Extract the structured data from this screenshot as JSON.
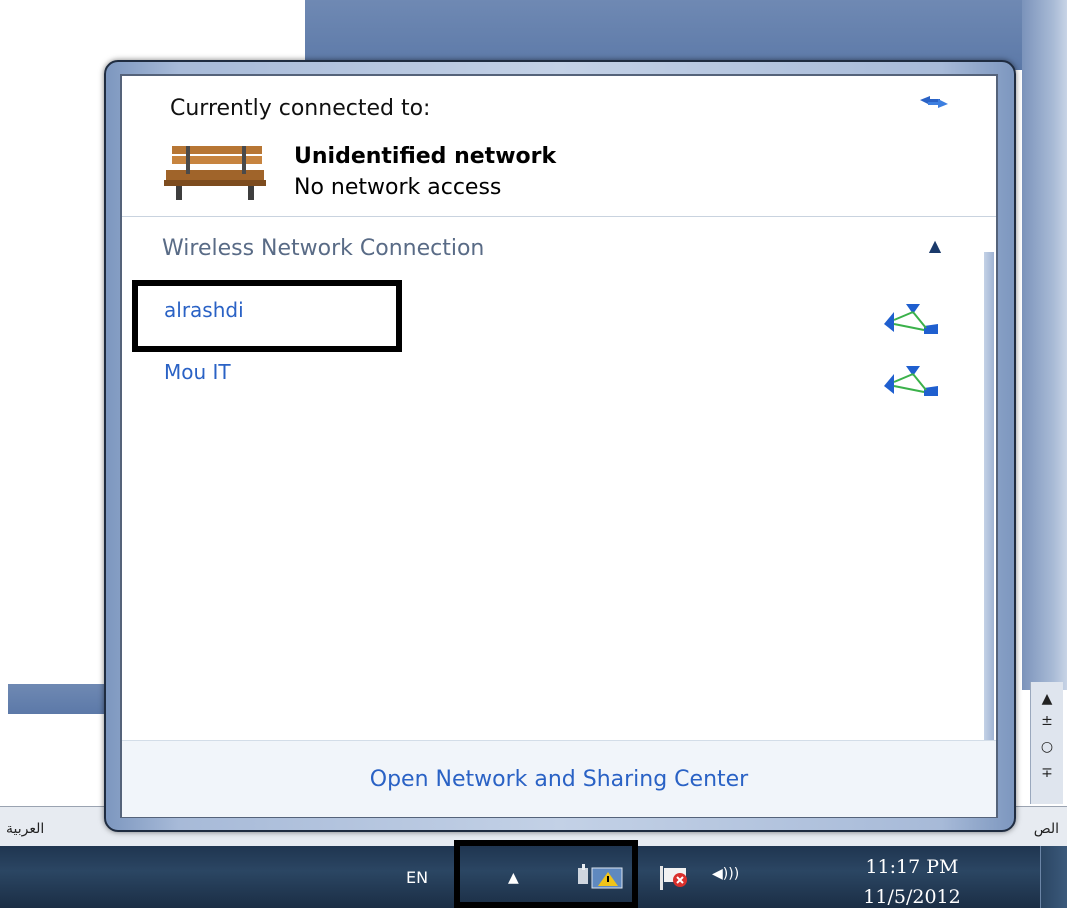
{
  "flyout": {
    "connected_label": "Currently connected to:",
    "network_name": "Unidentified network",
    "network_status": "No network access",
    "section_title": "Wireless Network Connection",
    "networks": [
      {
        "name": "alrashdi"
      },
      {
        "name": "Mou IT"
      }
    ],
    "footer_link": "Open Network and Sharing Center"
  },
  "background": {
    "lang_left": "العربية",
    "lang_right": "الص"
  },
  "taskbar": {
    "language": "EN",
    "time": "11:17 PM",
    "date": "11/5/2012"
  },
  "colors": {
    "link": "#2a62c5",
    "section": "#596b86",
    "taskbar": "#2b4663"
  }
}
